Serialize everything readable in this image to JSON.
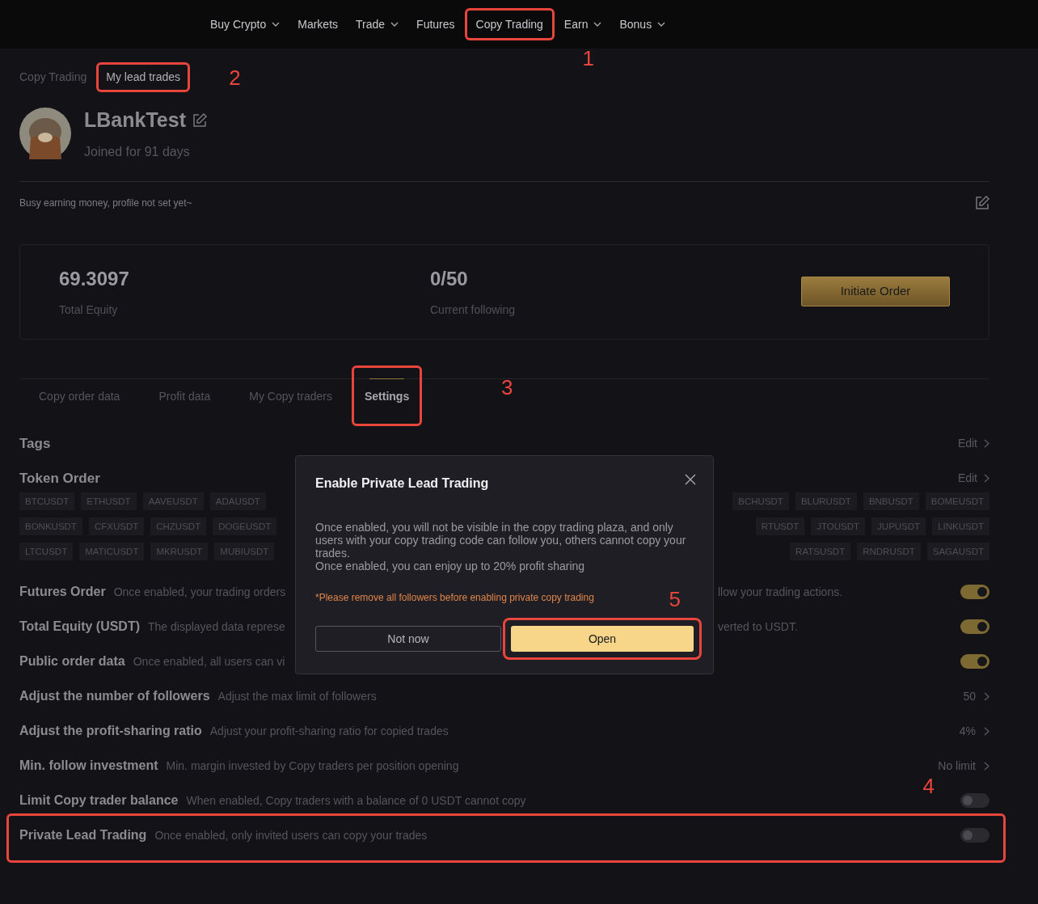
{
  "nav": [
    {
      "label": "Buy Crypto",
      "dropdown": true
    },
    {
      "label": "Markets",
      "dropdown": false
    },
    {
      "label": "Trade",
      "dropdown": true
    },
    {
      "label": "Futures",
      "dropdown": false
    },
    {
      "label": "Copy Trading",
      "dropdown": false,
      "callout": "1"
    },
    {
      "label": "Earn",
      "dropdown": true
    },
    {
      "label": "Bonus",
      "dropdown": true
    }
  ],
  "breadcrumb": [
    {
      "label": "Copy Trading"
    },
    {
      "label": "My lead trades",
      "callout": "2"
    }
  ],
  "profile": {
    "name": "LBankTest",
    "joined": "Joined for 91 days",
    "bio": "Busy earning money, profile not set yet~"
  },
  "stats": [
    {
      "value": "69.3097",
      "label": "Total Equity"
    },
    {
      "value": "0/50",
      "label": "Current following"
    }
  ],
  "initiate_button": "Initiate Order",
  "tabs": [
    {
      "label": "Copy order data",
      "selected": false
    },
    {
      "label": "Profit data",
      "selected": false
    },
    {
      "label": "My Copy traders",
      "selected": false
    },
    {
      "label": "Settings",
      "selected": true,
      "callout": "3"
    }
  ],
  "tags": {
    "title": "Tags",
    "action": "Edit"
  },
  "token_order": {
    "title": "Token Order",
    "action": "Edit",
    "rows": [
      {
        "left": [
          "BTCUSDT",
          "ETHUSDT",
          "AAVEUSDT",
          "ADAUSDT"
        ],
        "right": [
          "BCHUSDT",
          "BLURUSDT",
          "BNBUSDT",
          "BOMEUSDT"
        ]
      },
      {
        "left": [
          "BONKUSDT",
          "CFXUSDT",
          "CHZUSDT",
          "DOGEUSDT"
        ],
        "right": [
          "RTUSDT",
          "JTOUSDT",
          "JUPUSDT",
          "LINKUSDT"
        ]
      },
      {
        "left": [
          "LTCUSDT",
          "MATICUSDT",
          "MKRUSDT",
          "MUBIUSDT"
        ],
        "right": [
          "RATSUSDT",
          "RNDRUSDT",
          "SAGAUSDT"
        ]
      }
    ]
  },
  "settings": [
    {
      "kind": "toggle",
      "title": "Futures Order",
      "description": "Once enabled, your trading orders",
      "description_end": "llow your trading actions.",
      "on": true
    },
    {
      "kind": "toggle",
      "title": "Total Equity (USDT)",
      "description": "The displayed data represe",
      "description_end": "verted to USDT.",
      "on": true
    },
    {
      "kind": "toggle",
      "title": "Public order data",
      "description": "Once enabled, all users can vi",
      "on": true
    },
    {
      "kind": "link",
      "title": "Adjust the number of followers",
      "description": "Adjust the max limit of followers",
      "value": "50"
    },
    {
      "kind": "link",
      "title": "Adjust the profit-sharing ratio",
      "description": "Adjust your profit-sharing ratio for copied trades",
      "value": "4%"
    },
    {
      "kind": "link",
      "title": "Min. follow investment",
      "description": "Min. margin invested by Copy traders per position opening",
      "value": "No limit"
    },
    {
      "kind": "toggle",
      "title": "Limit Copy trader balance",
      "description": "When enabled, Copy traders with a balance of 0 USDT cannot copy",
      "on": false,
      "callout": "4"
    },
    {
      "kind": "toggle",
      "title": "Private Lead Trading",
      "description": "Once enabled, only invited users can copy your trades",
      "on": false,
      "framed": true
    }
  ],
  "dialog": {
    "title": "Enable Private Lead Trading",
    "body": "Once enabled, you will not be visible in the copy trading plaza, and only users with your copy trading code can follow you, others cannot copy your trades.",
    "body_2": "Once enabled, you can enjoy up to 20% profit sharing",
    "warning": "*Please remove all followers before enabling private copy trading",
    "warning_callout": "5",
    "cancel": "Not now",
    "confirm": "Open",
    "confirm_framed": true
  }
}
